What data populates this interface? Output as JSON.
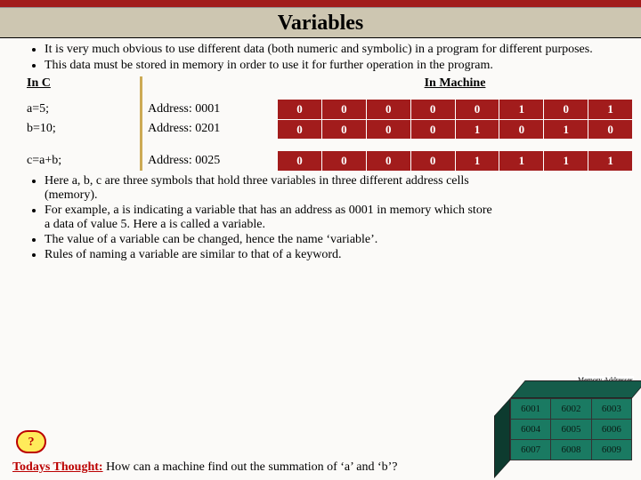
{
  "title": "Variables",
  "intro": [
    "It is very much obvious to use different data (both numeric and symbolic) in a program for different purposes.",
    "This data must be stored in memory in order to use it for further operation in the program."
  ],
  "headings": {
    "c": "In C",
    "machine": "In Machine"
  },
  "rows": [
    {
      "code": [
        "a=5;",
        "b=10;"
      ],
      "addr": [
        "Address: 0001",
        "Address: 0201"
      ],
      "bits": [
        [
          0,
          0,
          0,
          0,
          0,
          1,
          0,
          1
        ],
        [
          0,
          0,
          0,
          0,
          1,
          0,
          1,
          0
        ]
      ]
    },
    {
      "code": [
        "c=a+b;"
      ],
      "addr": [
        "Address: 0025"
      ],
      "bits": [
        [
          0,
          0,
          0,
          0,
          1,
          1,
          1,
          1
        ]
      ]
    }
  ],
  "notes": [
    "Here a, b, c are three symbols that hold three variables in three different address cells (memory).",
    "For example, a is indicating a variable that has an address as 0001 in memory which store a data of value 5. Here a is called a variable.",
    "The value of a variable can be changed, hence the name ‘variable’.",
    "Rules of naming a variable are similar to that of a keyword."
  ],
  "question_mark": "?",
  "thought_label": "Todays Thought:",
  "thought_text": " How can a machine find out the summation of ‘a’ and ‘b’?",
  "memory_label": "Memory Addresses",
  "memory_cells": [
    [
      "6001",
      "6002",
      "6003"
    ],
    [
      "6004",
      "6005",
      "6006"
    ],
    [
      "6007",
      "6008",
      "6009"
    ]
  ]
}
